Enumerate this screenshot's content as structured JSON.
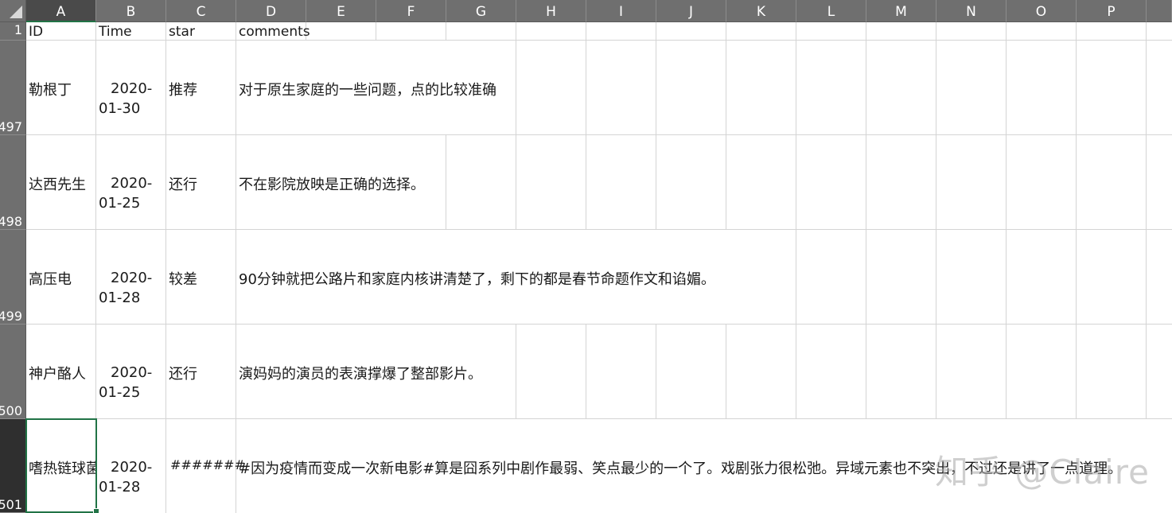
{
  "sheet": {
    "columns": [
      "A",
      "B",
      "C",
      "D",
      "E",
      "F",
      "G",
      "H",
      "I",
      "J",
      "K",
      "L",
      "M",
      "N",
      "O",
      "P"
    ],
    "selected_column": "A",
    "header_row": {
      "row_number": "1",
      "cells": [
        "ID",
        "Time",
        "star",
        "comments"
      ]
    },
    "rows": [
      {
        "row_number": "497",
        "id": "勒根丁",
        "time": "2020-\n01-30",
        "star": "推荐",
        "comment": "对于原生家庭的一些问题，点的比较准确"
      },
      {
        "row_number": "498",
        "id": "达西先生",
        "time": "2020-\n01-25",
        "star": "还行",
        "comment": "不在影院放映是正确的选择。"
      },
      {
        "row_number": "499",
        "id": "高压电",
        "time": "2020-\n01-28",
        "star": "较差",
        "comment": "90分钟就把公路片和家庭内核讲清楚了，剩下的都是春节命题作文和谄媚。"
      },
      {
        "row_number": "500",
        "id": "神户酪人",
        "time": "2020-\n01-25",
        "star": "还行",
        "comment": "演妈妈的演员的表演撑爆了整部影片。"
      },
      {
        "row_number": "501",
        "id": "嗜热链球菌",
        "time": "2020-\n01-28",
        "star": "#######",
        "comment": "#因为疫情而变成一次新电影#算是囧系列中剧作最弱、笑点最少的一个了。戏剧张力很松弛。异域元素也不突出，不过还是讲了一点道理。"
      }
    ]
  },
  "watermark": "知乎 @Claire",
  "colors": {
    "header_bg": "#6f6f6f",
    "selected_header_bg": "#2f2f2f",
    "selection_green": "#217346",
    "gridline": "#d4d4d4"
  },
  "icons": {
    "corner": "select-all-triangle-icon"
  }
}
